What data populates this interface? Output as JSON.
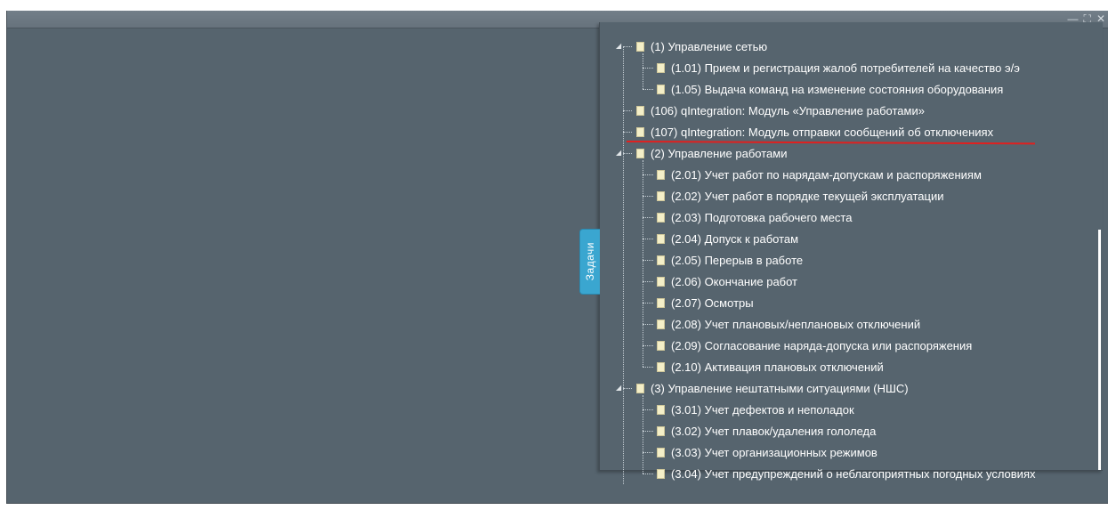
{
  "window": {
    "controls": {
      "minimize": "—",
      "maximize": "⛶",
      "close": "✕"
    }
  },
  "side_tab": {
    "label": "Задачи"
  },
  "tree": [
    {
      "label": "(1) Управление сетью",
      "level": 0,
      "expandable": true
    },
    {
      "label": "(1.01) Прием и регистрация жалоб потребителей на качество э/э",
      "level": 1
    },
    {
      "label": "(1.05) Выдача команд на изменение состояния оборудования",
      "level": 1
    },
    {
      "label": "(106) qIntegration: Модуль «Управление работами»",
      "level": 0
    },
    {
      "label": "(107) qIntegration: Модуль отправки сообщений об отключениях",
      "level": 0,
      "highlighted": true
    },
    {
      "label": "(2) Управление работами",
      "level": 0,
      "expandable": true
    },
    {
      "label": "(2.01) Учет работ по нарядам-допускам и распоряжениям",
      "level": 1
    },
    {
      "label": "(2.02) Учет работ в порядке текущей эксплуатации",
      "level": 1
    },
    {
      "label": "(2.03) Подготовка рабочего места",
      "level": 1
    },
    {
      "label": "(2.04) Допуск к работам",
      "level": 1
    },
    {
      "label": "(2.05) Перерыв в работе",
      "level": 1
    },
    {
      "label": "(2.06) Окончание работ",
      "level": 1
    },
    {
      "label": "(2.07) Осмотры",
      "level": 1
    },
    {
      "label": "(2.08) Учет плановых/неплановых отключений",
      "level": 1
    },
    {
      "label": "(2.09) Согласование наряда-допуска или распоряжения",
      "level": 1
    },
    {
      "label": "(2.10) Активация плановых отключений",
      "level": 1
    },
    {
      "label": "(3) Управление нештатными ситуациями (НШС)",
      "level": 0,
      "expandable": true
    },
    {
      "label": "(3.01) Учет дефектов и неполадок",
      "level": 1
    },
    {
      "label": "(3.02) Учет плавок/удаления гололеда",
      "level": 1
    },
    {
      "label": "(3.03) Учет организационных режимов",
      "level": 1
    },
    {
      "label": "(3.04) Учет предупреждений о неблагоприятных погодных условиях",
      "level": 1
    }
  ],
  "colors": {
    "window_bg": "#56646e",
    "tab_bg": "#3aa6d0",
    "highlight_line": "#e0201f",
    "doc_icon": "#f4efc8"
  }
}
